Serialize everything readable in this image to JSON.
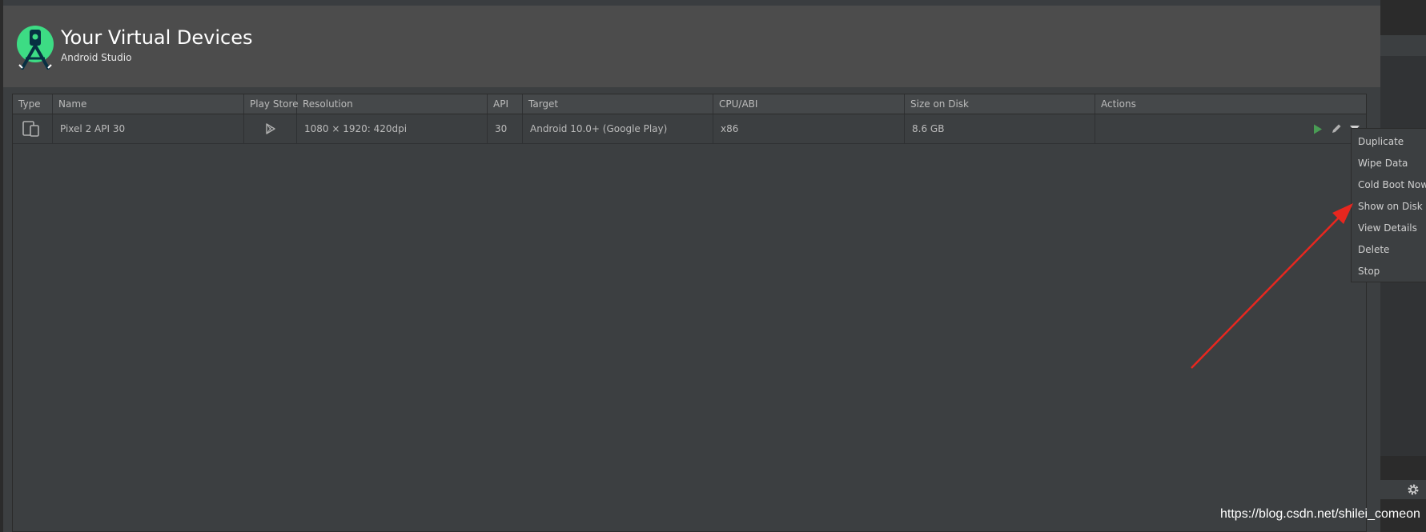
{
  "header": {
    "title": "Your Virtual Devices",
    "subtitle": "Android Studio"
  },
  "table": {
    "columns": [
      "Type",
      "Name",
      "Play Store",
      "Resolution",
      "API",
      "Target",
      "CPU/ABI",
      "Size on Disk",
      "Actions"
    ],
    "rows": [
      {
        "type_icon": "phone-tablet-icon",
        "name": "Pixel 2 API 30",
        "play_store_icon": "play-store-icon",
        "resolution": "1080 × 1920: 420dpi",
        "api": "30",
        "target": "Android 10.0+ (Google Play)",
        "cpu_abi": "x86",
        "size_on_disk": "8.6 GB"
      }
    ]
  },
  "actions_menu": {
    "items": [
      "Duplicate",
      "Wipe Data",
      "Cold Boot Now",
      "Show on Disk",
      "View Details",
      "Delete",
      "Stop"
    ]
  },
  "watermark": "https://blog.csdn.net/shilei_comeon",
  "colors": {
    "run_green": "#499c54",
    "annotation_red": "#e8271f",
    "android_green": "#3ddc84"
  }
}
